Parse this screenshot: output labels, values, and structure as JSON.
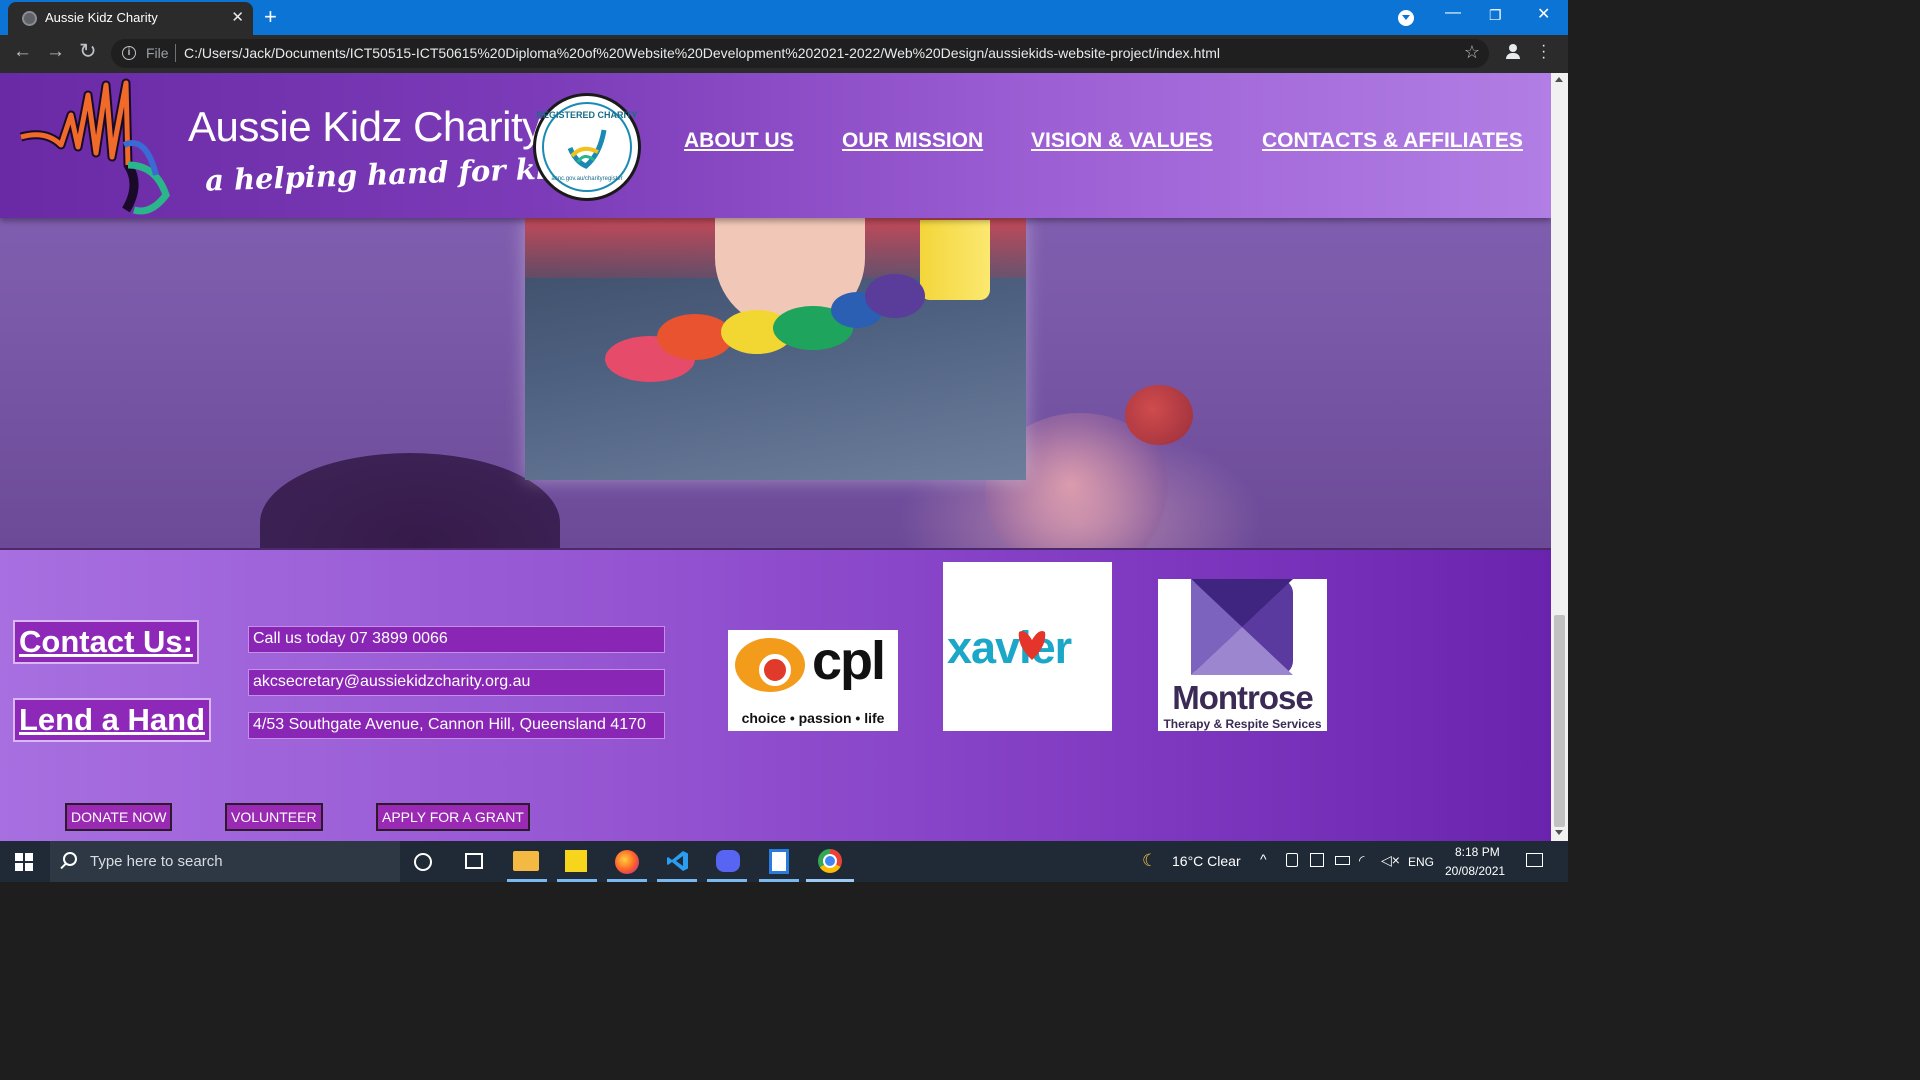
{
  "browser": {
    "tab_title": "Aussie Kidz Charity",
    "tab_close": "✕",
    "new_tab": "+",
    "scheme": "File",
    "url": "C:/Users/Jack/Documents/ICT50515-ICT50615%20Diploma%20of%20Website%20Development%202021-2022/Web%20Design/aussiekids-website-project/index.html",
    "back": "←",
    "forward": "→",
    "reload": "↻",
    "star": "☆",
    "minimize": "—",
    "restore": "❐",
    "close": "✕"
  },
  "header": {
    "brand": "Aussie Kidz Charity",
    "tagline": "a helping hand for kidz",
    "badge_text": "REGISTERED CHARITY",
    "badge_foot": "acnc.gov.au/charityregister",
    "nav": [
      "ABOUT US",
      "OUR MISSION",
      "VISION & VALUES",
      "CONTACTS & AFFILIATES"
    ]
  },
  "footer": {
    "contact_link": "Contact Us:",
    "lend_link": "Lend a Hand",
    "phone": "Call us today 07 3899 0066",
    "email": "akcsecretary@aussiekidzcharity.org.au",
    "address": "4/53 Southgate Avenue, Cannon Hill, Queensland 4170",
    "buttons": [
      "DONATE NOW",
      "VOLUNTEER",
      "APPLY FOR A GRANT"
    ],
    "partners": {
      "cpl_name": "cpl",
      "cpl_tagline": "choice • passion • life",
      "xavier_name": "xavier",
      "montrose_name": "Montrose",
      "montrose_tagline": "Therapy & Respite Services"
    }
  },
  "taskbar": {
    "search_placeholder": "Type here to search",
    "weather": "16°C  Clear",
    "language": "ENG",
    "time": "8:18 PM",
    "date": "20/08/2021"
  },
  "colors": {
    "header_start": "#6a2aa5",
    "header_end": "#b17ee4",
    "footer_box": "#8a26b5",
    "browser_blue": "#0b74d4"
  }
}
